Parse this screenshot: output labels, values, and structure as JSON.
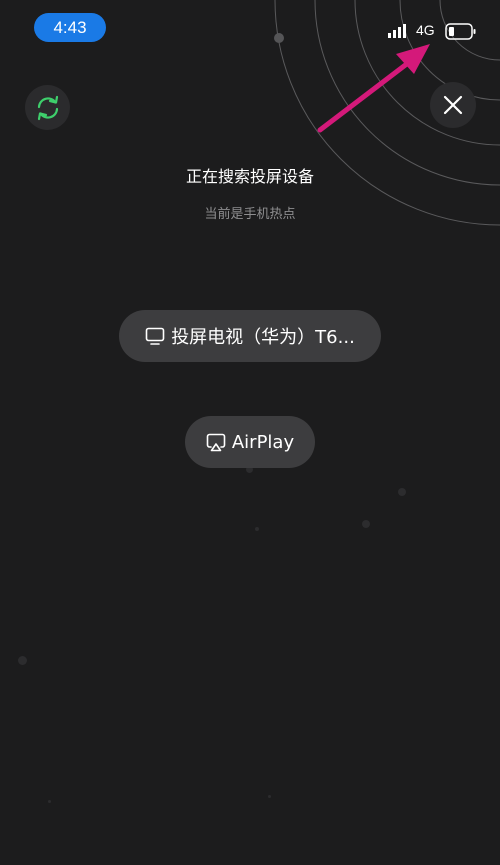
{
  "status_bar": {
    "time": "4:43",
    "network": "4G",
    "signal_icon": "signal-bars-icon",
    "battery_icon": "battery-low-icon"
  },
  "header": {
    "refresh_icon": "refresh-icon",
    "close_icon": "close-icon",
    "title": "正在搜索投屏设备",
    "subtitle": "当前是手机热点"
  },
  "devices": [
    {
      "label": "投屏电视（华为）T6...",
      "icon": "tv-icon"
    },
    {
      "label": "AirPlay",
      "icon": "airplay-icon"
    }
  ],
  "annotation": {
    "arrow_color": "#d4197a"
  },
  "colors": {
    "background": "#1c1c1d",
    "time_pill": "#1a7ae6",
    "refresh_green": "#3ecf6c",
    "button_bg": "#3d3d3f"
  }
}
